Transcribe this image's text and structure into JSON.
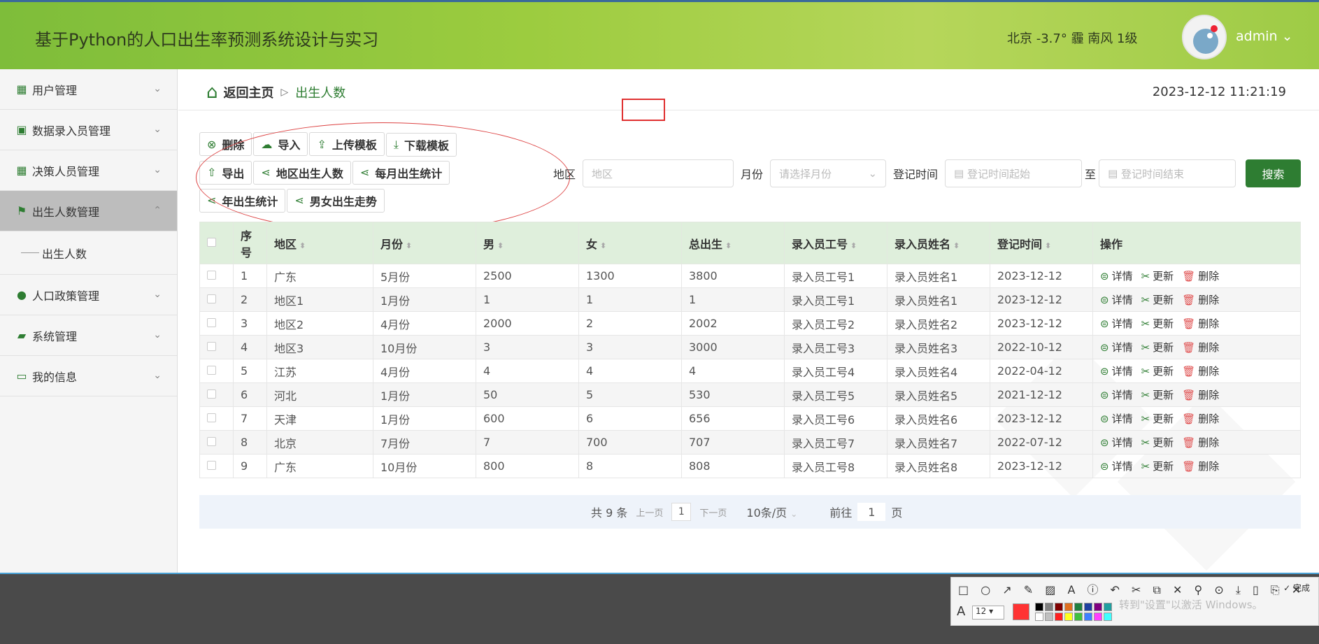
{
  "header": {
    "title": "基于Python的人口出生率预测系统设计与实习",
    "weather": "北京 -3.7° 霾 南风 1级",
    "user": "admin"
  },
  "sidebar": {
    "items": [
      {
        "label": "用户管理",
        "icon": "grid-icon"
      },
      {
        "label": "数据录入员管理",
        "icon": "clipboard-icon"
      },
      {
        "label": "决策人员管理",
        "icon": "grid-icon"
      },
      {
        "label": "出生人数管理",
        "icon": "flag-icon",
        "active": true
      },
      {
        "label": "人口政策管理",
        "icon": "bulb-icon"
      },
      {
        "label": "系统管理",
        "icon": "wallet-icon"
      },
      {
        "label": "我的信息",
        "icon": "card-icon"
      }
    ],
    "submenu": "出生人数"
  },
  "breadcrumb": {
    "back": "返回主页",
    "current": "出生人数"
  },
  "datetime": "2023-12-12 11:21:19",
  "toolbar": {
    "delete": "删除",
    "import": "导入",
    "upload_template": "上传模板",
    "download_template": "下载模板",
    "export": "导出",
    "region_births": "地区出生人数",
    "monthly_stats": "每月出生统计",
    "yearly_stats": "年出生统计",
    "gender_trend": "男女出生走势"
  },
  "filters": {
    "region_label": "地区",
    "region_placeholder": "地区",
    "month_label": "月份",
    "month_placeholder": "请选择月份",
    "time_label": "登记时间",
    "time_start": "登记时间起始",
    "to": "至",
    "time_end": "登记时间结束",
    "search": "搜索"
  },
  "table": {
    "headers": [
      "序号",
      "地区",
      "月份",
      "男",
      "女",
      "总出生",
      "录入员工号",
      "录入员姓名",
      "登记时间",
      "操作"
    ],
    "rows": [
      [
        "1",
        "广东",
        "5月份",
        "2500",
        "1300",
        "3800",
        "录入员工号1",
        "录入员姓名1",
        "2023-12-12"
      ],
      [
        "2",
        "地区1",
        "1月份",
        "1",
        "1",
        "1",
        "录入员工号1",
        "录入员姓名1",
        "2023-12-12"
      ],
      [
        "3",
        "地区2",
        "4月份",
        "2000",
        "2",
        "2002",
        "录入员工号2",
        "录入员姓名2",
        "2023-12-12"
      ],
      [
        "4",
        "地区3",
        "10月份",
        "3",
        "3",
        "3000",
        "录入员工号3",
        "录入员姓名3",
        "2022-10-12"
      ],
      [
        "5",
        "江苏",
        "4月份",
        "4",
        "4",
        "4",
        "录入员工号4",
        "录入员姓名4",
        "2022-04-12"
      ],
      [
        "6",
        "河北",
        "1月份",
        "50",
        "5",
        "530",
        "录入员工号5",
        "录入员姓名5",
        "2021-12-12"
      ],
      [
        "7",
        "天津",
        "1月份",
        "600",
        "6",
        "656",
        "录入员工号6",
        "录入员姓名6",
        "2023-12-12"
      ],
      [
        "8",
        "北京",
        "7月份",
        "7",
        "700",
        "707",
        "录入员工号7",
        "录入员姓名7",
        "2022-07-12"
      ],
      [
        "9",
        "广东",
        "10月份",
        "800",
        "8",
        "808",
        "录入员工号8",
        "录入员姓名8",
        "2023-12-12"
      ]
    ],
    "actions": {
      "detail": "详情",
      "update": "更新",
      "delete": "删除"
    }
  },
  "pagination": {
    "total": "共 9 条",
    "prev": "上一页",
    "page": "1",
    "next": "下一页",
    "per_page": "10条/页",
    "goto": "前往",
    "goto_value": "1",
    "page_suffix": "页"
  },
  "snip": {
    "done": "完成",
    "font_size": "12",
    "watermark": "转到\"设置\"以激活 Windows。"
  },
  "colors": {
    "accent": "#2e7d32",
    "header_bg": "#9ccc3f",
    "table_header": "#dfefdc"
  }
}
